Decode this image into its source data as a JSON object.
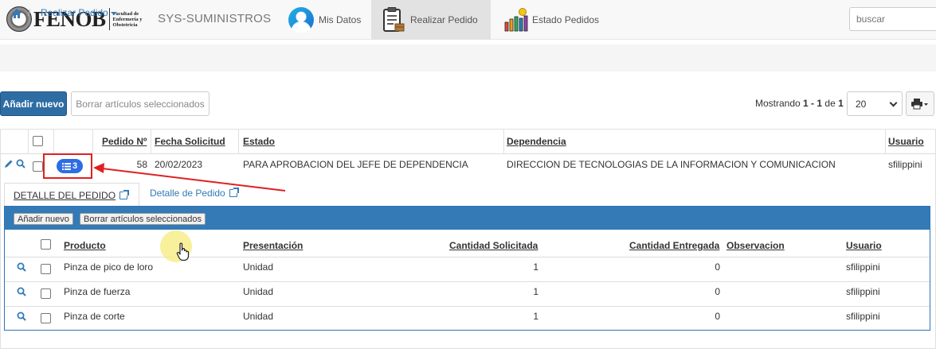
{
  "navbar": {
    "logo_word": "FENOB",
    "logo_sub": [
      "Facultad de",
      "Enfermería y",
      "Obstetricia"
    ],
    "brand": "SYS-SUMINISTROS",
    "items": [
      {
        "label": "Mis Datos"
      },
      {
        "label": "Realizar Pedido",
        "active": true
      },
      {
        "label": "Estado Pedidos"
      }
    ],
    "search_placeholder": "buscar"
  },
  "breadcrumb": {
    "current": "Realizar Pedido"
  },
  "toolbar": {
    "add_label": "Añadir nuevo",
    "delete_label": "Borrar artículos seleccionados",
    "showing_prefix": "Mostrando ",
    "showing_from": "1",
    "showing_sep": " - ",
    "showing_to": "1",
    "showing_of": " de ",
    "showing_total": "1",
    "page_size": "20"
  },
  "main_table": {
    "headers": [
      "Pedido Nº",
      "Fecha Solicitud",
      "Estado",
      "Dependencia",
      "Usuario"
    ],
    "rows": [
      {
        "pedido": "58",
        "fecha": "20/02/2023",
        "estado": "PARA APROBACION DEL JEFE DE DEPENDENCIA",
        "dependencia": "DIRECCION DE TECNOLOGIAS DE LA INFORMACION Y COMUNICACION",
        "usuario": "sfilippini",
        "detail_count": "3"
      }
    ]
  },
  "detail": {
    "tabs": [
      "DETALLE DEL PEDIDO",
      "Detalle de Pedido"
    ],
    "add_label": "Añadir nuevo",
    "delete_label": "Borrar artículos seleccionados",
    "headers": [
      "Producto",
      "Presentación",
      "Cantidad Solicitada",
      "Cantidad Entregada",
      "Observacion",
      "Usuario"
    ],
    "rows": [
      {
        "producto": "Pinza de pico de loro",
        "presentacion": "Unidad",
        "solicitada": "1",
        "entregada": "0",
        "observacion": "",
        "usuario": "sfilippini"
      },
      {
        "producto": "Pinza de fuerza",
        "presentacion": "Unidad",
        "solicitada": "1",
        "entregada": "0",
        "observacion": "",
        "usuario": "sfilippini"
      },
      {
        "producto": "Pinza de corte",
        "presentacion": "Unidad",
        "solicitada": "1",
        "entregada": "0",
        "observacion": "",
        "usuario": "sfilippini"
      }
    ]
  },
  "colors": {
    "primary": "#2e6da4",
    "link": "#337ab7",
    "badge": "#2e6ce3",
    "annotation": "#e02020"
  }
}
